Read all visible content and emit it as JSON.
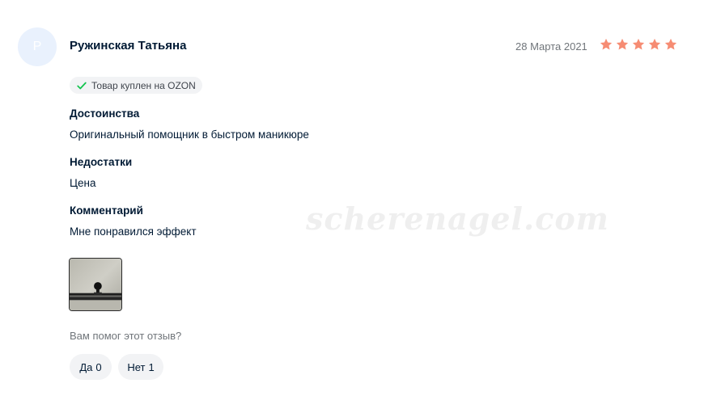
{
  "review": {
    "avatar_letter": "Р",
    "author": "Ружинская Татьяна",
    "date": "28 Марта 2021",
    "rating": 5,
    "star_color": "#f68c73",
    "verified_label": "Товар куплен на OZON",
    "verified_icon": "check-icon",
    "sections": [
      {
        "title": "Достоинства",
        "text": "Оригинальный помощник в быстром маникюре"
      },
      {
        "title": "Недостатки",
        "text": "Цена"
      },
      {
        "title": "Комментарий",
        "text": "Мне понравился эффект"
      }
    ],
    "watermark": "scherenagel.com",
    "helpful_question": "Вам помог этот отзыв?",
    "votes": {
      "yes_label": "Да",
      "yes_count": "0",
      "no_label": "Нет",
      "no_count": "1"
    }
  }
}
